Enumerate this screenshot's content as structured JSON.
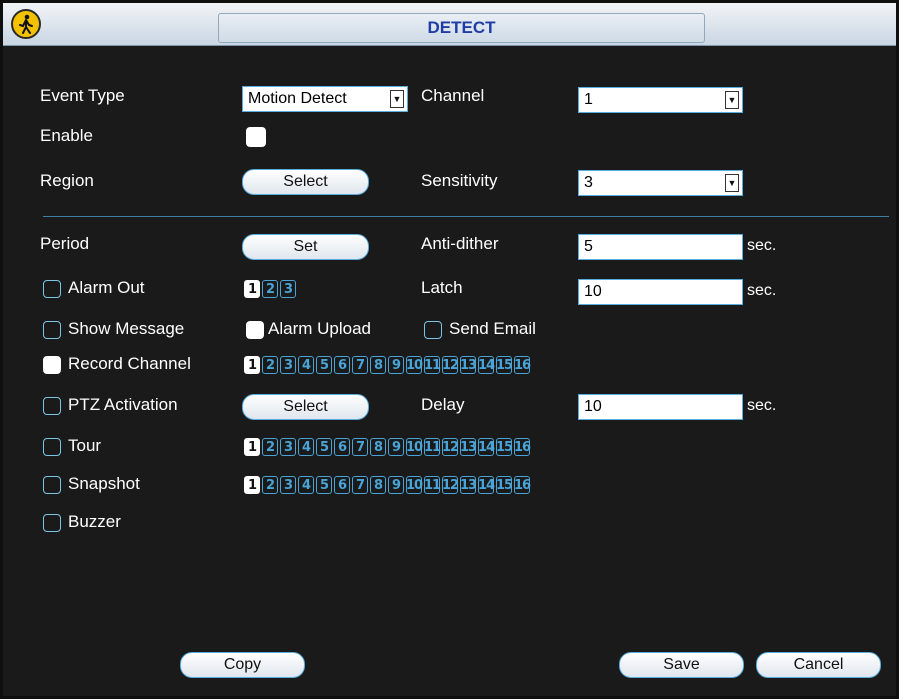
{
  "window": {
    "title": "DETECT"
  },
  "icons": {
    "title_icon": "pedestrian-sign-icon"
  },
  "fields": {
    "event_type_label": "Event Type",
    "event_type_value": "Motion Detect",
    "channel_label": "Channel",
    "channel_value": "1",
    "enable_label": "Enable",
    "region_label": "Region",
    "region_button": "Select",
    "sensitivity_label": "Sensitivity",
    "sensitivity_value": "3",
    "period_label": "Period",
    "period_button": "Set",
    "anti_dither_label": "Anti-dither",
    "anti_dither_value": "5",
    "anti_dither_unit": "sec.",
    "alarm_out_label": "Alarm Out",
    "latch_label": "Latch",
    "latch_value": "10",
    "latch_unit": "sec.",
    "show_message_label": "Show Message",
    "alarm_upload_label": "Alarm Upload",
    "send_email_label": "Send Email",
    "record_channel_label": "Record Channel",
    "ptz_label": "PTZ Activation",
    "ptz_button": "Select",
    "delay_label": "Delay",
    "delay_value": "10",
    "delay_unit": "sec.",
    "tour_label": "Tour",
    "snapshot_label": "Snapshot",
    "buzzer_label": "Buzzer"
  },
  "checks": {
    "enable": true,
    "alarm_out": false,
    "show_message": false,
    "alarm_upload": true,
    "send_email": false,
    "record_channel": true,
    "ptz_activation": false,
    "tour": false,
    "snapshot": false,
    "buzzer": false
  },
  "alarm_out_channels": [
    "1",
    "2",
    "3"
  ],
  "channels16": [
    "1",
    "2",
    "3",
    "4",
    "5",
    "6",
    "7",
    "8",
    "9",
    "10",
    "11",
    "12",
    "13",
    "14",
    "15",
    "16"
  ],
  "selected_channels": [
    "1"
  ],
  "footer": {
    "copy": "Copy",
    "save": "Save",
    "cancel": "Cancel"
  },
  "colors": {
    "accent": "#4aa4d8",
    "title_text": "#1f3ea5",
    "background": "#1a1a1a"
  }
}
